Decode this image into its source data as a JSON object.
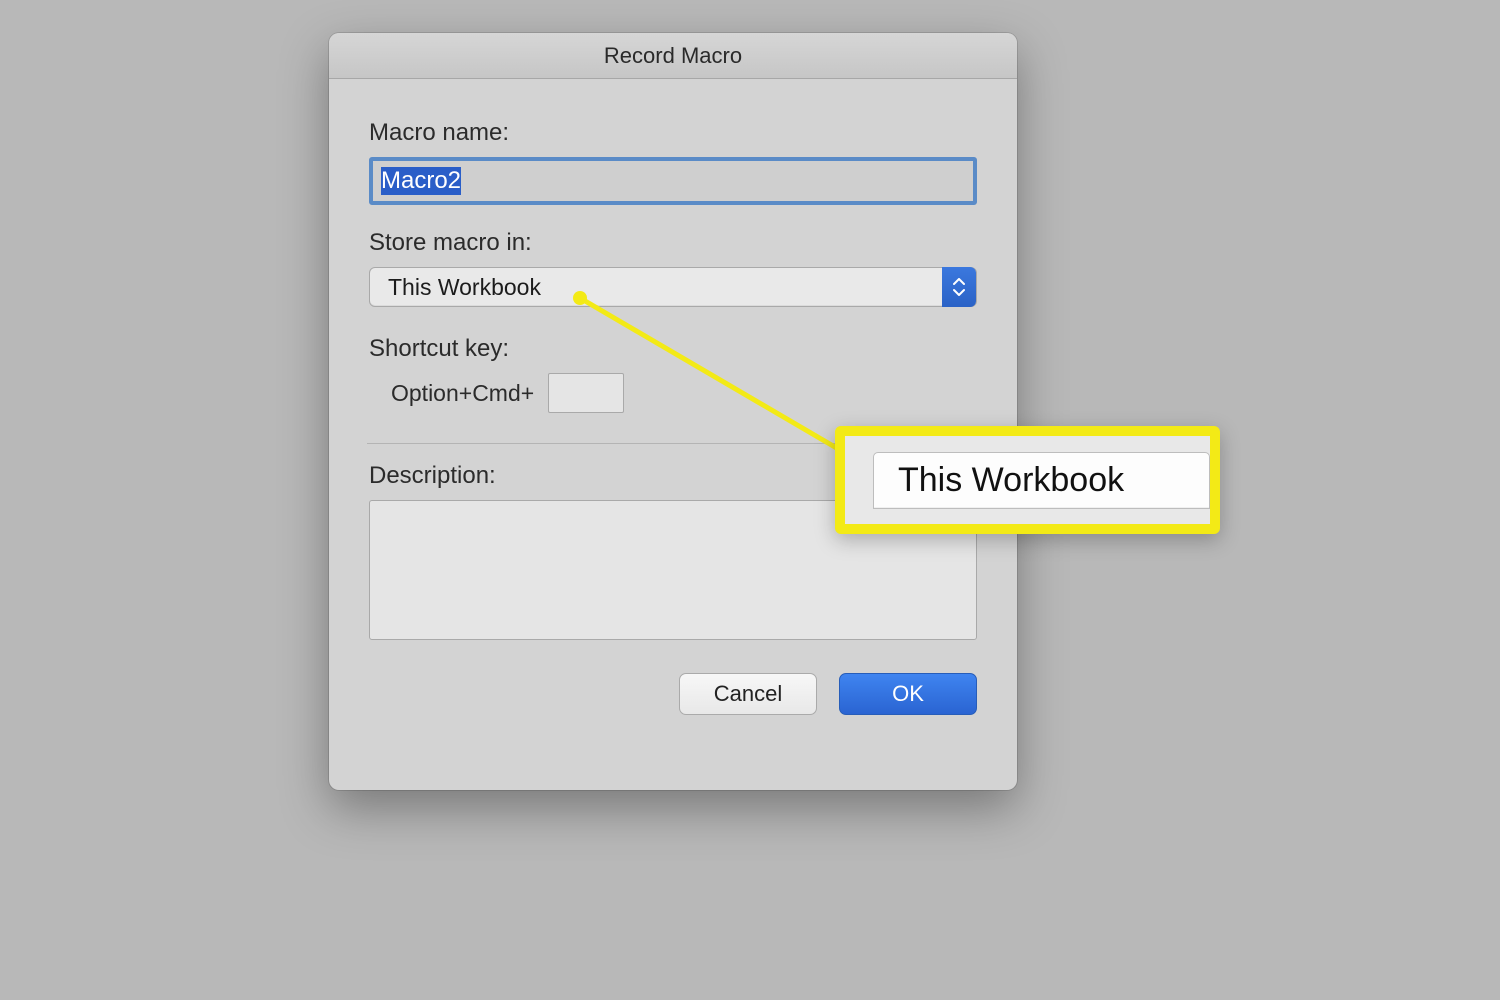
{
  "dialog": {
    "title": "Record Macro",
    "macro_name_label": "Macro name:",
    "macro_name_value": "Macro2",
    "store_label": "Store macro in:",
    "store_value": "This Workbook",
    "shortcut_label": "Shortcut key:",
    "shortcut_prefix": "Option+Cmd+",
    "shortcut_value": "",
    "description_label": "Description:",
    "description_value": "",
    "cancel_label": "Cancel",
    "ok_label": "OK"
  },
  "annotation": {
    "callout_text": "This Workbook"
  }
}
